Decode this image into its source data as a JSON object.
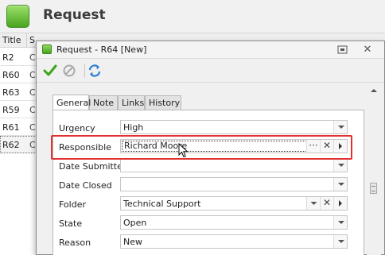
{
  "app": {
    "title": "Request"
  },
  "list": {
    "columns": [
      "Title",
      "S"
    ],
    "rows": [
      {
        "title": "R2",
        "c2": "C"
      },
      {
        "title": "R60",
        "c2": "C"
      },
      {
        "title": "R63",
        "c2": "C"
      },
      {
        "title": "R59",
        "c2": "C"
      },
      {
        "title": "R61",
        "c2": "C"
      },
      {
        "title": "R62",
        "c2": "C"
      }
    ]
  },
  "dialog": {
    "title": "Request - R64 [New]",
    "toolbar": {
      "save_icon": "checkmark-icon",
      "cancel_icon": "cancel-icon",
      "refresh_icon": "refresh-icon"
    },
    "tabs": [
      "General",
      "Note",
      "Links",
      "History"
    ],
    "fields": {
      "urgency": {
        "label": "Urgency",
        "value": "High"
      },
      "responsible": {
        "label": "Responsible",
        "value": "Richard Moore"
      },
      "date_submitted": {
        "label": "Date Submitted",
        "value": ""
      },
      "date_closed": {
        "label": "Date Closed",
        "value": ""
      },
      "folder": {
        "label": "Folder",
        "value": "Technical Support"
      },
      "state": {
        "label": "State",
        "value": "Open"
      },
      "reason": {
        "label": "Reason",
        "value": "New"
      }
    },
    "ellipsis": "···",
    "clear": "✕"
  },
  "colors": {
    "highlight": "#e23131",
    "accent_green": "#4aa420",
    "refresh_blue": "#2a7fd4"
  }
}
